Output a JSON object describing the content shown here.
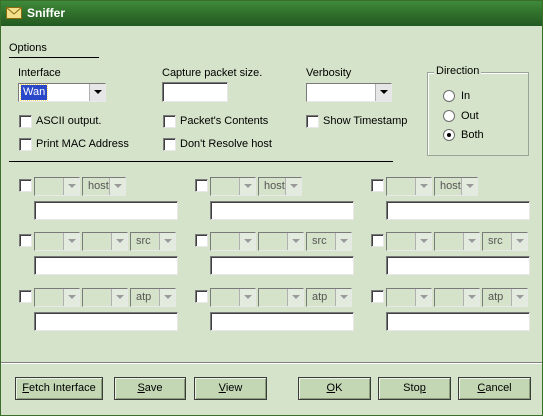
{
  "window": {
    "title": "Sniffer"
  },
  "options_label": "Options",
  "interface": {
    "label": "Interface",
    "value": "Wan"
  },
  "capture_size": {
    "label": "Capture packet size.",
    "value": ""
  },
  "verbosity": {
    "label": "Verbosity",
    "value": ""
  },
  "checks": {
    "ascii": "ASCII output.",
    "contents": "Packet's Contents",
    "timestamp": "Show Timestamp",
    "mac": "Print MAC Address",
    "resolve": "Don't Resolve host"
  },
  "direction": {
    "label": "Direction",
    "options": [
      "In",
      "Out",
      "Both"
    ],
    "selected": "Both"
  },
  "filters": {
    "row1_field": "host",
    "row2_field": "src",
    "row3_field": "atp"
  },
  "buttons": {
    "fetch_a": "F",
    "fetch_b": "etch Interface",
    "save_a": "S",
    "save_b": "ave",
    "view_a": "V",
    "view_b": "iew",
    "ok_a": "O",
    "ok_b": "K",
    "stop_a": "Sto",
    "stop_u": "p",
    "stop_b": "",
    "cancel_a": "",
    "cancel_u": "C",
    "cancel_b": "ancel"
  }
}
